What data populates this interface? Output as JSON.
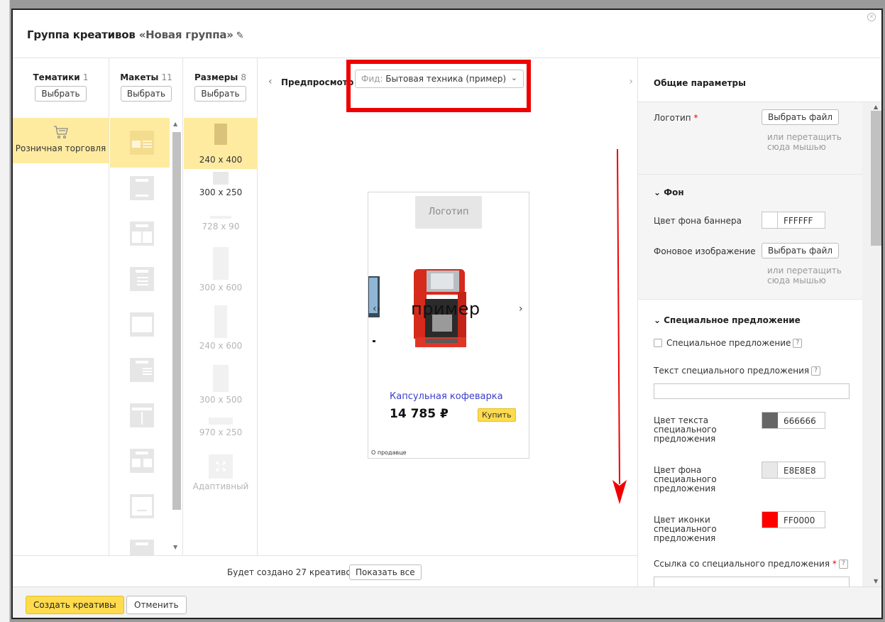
{
  "header": {
    "title_prefix": "Группа креативов ",
    "group_name": "«Новая группа»"
  },
  "columns": {
    "themes": {
      "title": "Тематики",
      "count": "1",
      "button": "Выбрать",
      "items": [
        {
          "label": "Розничная торговля"
        }
      ]
    },
    "layouts": {
      "title": "Макеты",
      "count": "11",
      "button": "Выбрать"
    },
    "sizes": {
      "title": "Размеры",
      "count": "8",
      "button": "Выбрать",
      "items": [
        {
          "label": "240 x 400"
        },
        {
          "label": "300 x 250"
        },
        {
          "label": "728 x 90"
        },
        {
          "label": "300 x 600"
        },
        {
          "label": "240 x 600"
        },
        {
          "label": "300 x 500"
        },
        {
          "label": "970 x 250"
        },
        {
          "label": "Адаптивный"
        }
      ]
    }
  },
  "preview": {
    "label": "Предпросмотр",
    "feed_prefix": "Фид:",
    "feed_value": " Бытовая техника (пример)",
    "banner": {
      "logo": "Логотип",
      "watermark": "пример",
      "product": "Капсульная кофеварка",
      "price": "14 785 ₽",
      "buy": "Купить",
      "seller": "О продавце"
    }
  },
  "footer": {
    "count_text": "Будет создано 27 креативов",
    "show_all": "Показать все",
    "create_button": "Создать креативы",
    "cancel_button": "Отменить"
  },
  "right_panel": {
    "title": "Общие параметры",
    "logo_label": "Логотип",
    "required_mark": "*",
    "choose_file": "Выбрать файл",
    "drag_hint_1": "или перетащить",
    "drag_hint_2": "сюда мышью",
    "bg_section": "Фон",
    "bg_color_label": "Цвет фона баннера",
    "bg_color_value": "FFFFFF",
    "bg_image_label": "Фоновое изображение",
    "offer_section": "Специальное предложение",
    "offer_checkbox": "Специальное предложение",
    "help": "?",
    "offer_text_label": "Текст специального предложения",
    "text_color_label": [
      "Цвет текста",
      "специального",
      "предложения"
    ],
    "text_color_value": "666666",
    "fill_color_label": [
      "Цвет фона",
      "специального",
      "предложения"
    ],
    "fill_color_value": "E8E8E8",
    "icon_color_label": [
      "Цвет иконки",
      "специального",
      "предложения"
    ],
    "icon_color_value": "FF0000",
    "link_label": "Ссылка со специального предложения"
  },
  "colors": {
    "accent_yellow": "#ffdb4d",
    "selection": "#ffeba0",
    "highlight_red": "#ee0000",
    "text_swatch": "#666666",
    "fill_swatch": "#e8e8e8",
    "icon_swatch": "#ff0000",
    "bg_swatch": "#ffffff"
  }
}
